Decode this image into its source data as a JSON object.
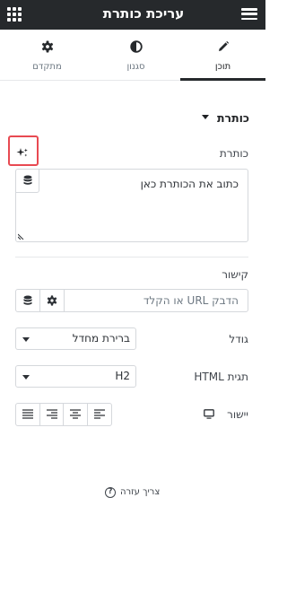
{
  "header": {
    "title": "עריכת כותרת",
    "menu_icon": "hamburger-icon",
    "apps_icon": "grid-icon"
  },
  "tabs": [
    {
      "label": "תוכן",
      "icon": "pencil-icon",
      "active": true
    },
    {
      "label": "סגנון",
      "icon": "half-circle-icon",
      "active": false
    },
    {
      "label": "מתקדם",
      "icon": "gear-icon",
      "active": false
    }
  ],
  "section": {
    "title": "כותרת"
  },
  "fields": {
    "title_label": "כותרת",
    "title_value": "כתוב את הכותרת כאן",
    "link_label": "קישור",
    "link_placeholder": "הדבק URL או הקלד",
    "size_label": "גודל",
    "size_value": "ברירת מחדל",
    "html_tag_label": "תגית HTML",
    "html_tag_value": "H2",
    "alignment_label": "יישור"
  },
  "help": {
    "label": "צריך עזרה"
  },
  "colors": {
    "header_bg": "#26292c",
    "highlight_border": "#e84a52",
    "border": "#d5d8dc"
  }
}
